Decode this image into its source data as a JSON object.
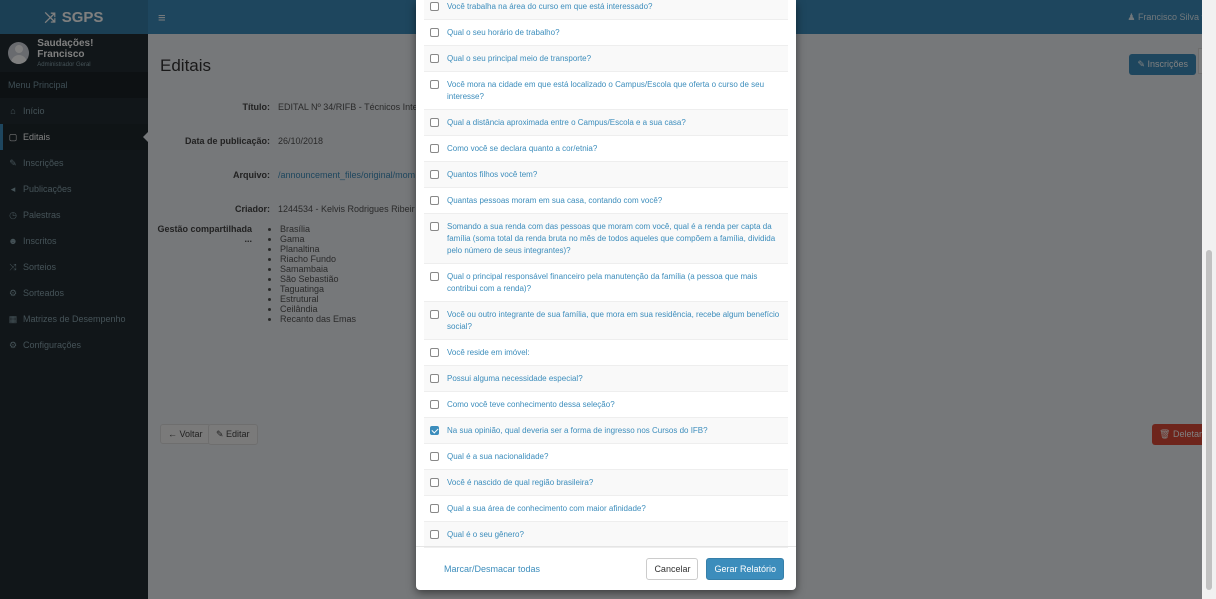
{
  "brand": {
    "name": "SGPS",
    "icon": "shuffle-icon"
  },
  "user": {
    "greeting": "Saudações! Francisco",
    "role": "Administrador Geral"
  },
  "topbar": {
    "menu_icon": "≡",
    "user_name": "Francisco Silva"
  },
  "sidebar": {
    "header": "Menu Principal",
    "items": [
      {
        "label": "Início",
        "icon": "home-icon"
      },
      {
        "label": "Editais",
        "icon": "file-icon"
      },
      {
        "label": "Inscrições",
        "icon": "pencil-icon"
      },
      {
        "label": "Publicações",
        "icon": "bullhorn-icon"
      },
      {
        "label": "Palestras",
        "icon": "clock-icon"
      },
      {
        "label": "Inscritos",
        "icon": "users-icon"
      },
      {
        "label": "Sorteios",
        "icon": "shuffle-icon"
      },
      {
        "label": "Sorteados",
        "icon": "gear-icon"
      },
      {
        "label": "Matrizes de Desempenho",
        "icon": "grid-icon"
      },
      {
        "label": "Configurações",
        "icon": "gears-icon"
      }
    ]
  },
  "page": {
    "title": "Editais",
    "inscricoes_button": "Inscrições",
    "fields": [
      {
        "label": "Título:",
        "value": "EDITAL Nº 34/RIFB - Técnicos Inte"
      },
      {
        "label": "Data de publicação:",
        "value": "26/10/2018"
      },
      {
        "label": "Arquivo:",
        "value": "/announcement_files/original/mom"
      },
      {
        "label": "Criador:",
        "value": "1244534 - Kelvis Rodrigues Ribeir"
      }
    ],
    "shared_label": "Gestão compartilhada ...",
    "shared_list": [
      "Brasília",
      "Gama",
      "Planaltina",
      "Riacho Fundo",
      "Samambaia",
      "São Sebastião",
      "Taguatinga",
      "Estrutural",
      "Ceilândia",
      "Recanto das Emas"
    ],
    "back_button": "Voltar",
    "edit_button": "Editar",
    "delete_button": "Deletar"
  },
  "modal": {
    "questions": [
      {
        "text": "Você trabalha na área do curso em que está interessado?",
        "checked": false
      },
      {
        "text": "Qual o seu horário de trabalho?",
        "checked": false
      },
      {
        "text": "Qual o seu principal meio de transporte?",
        "checked": false
      },
      {
        "text": "Você mora na cidade em que está localizado o Campus/Escola que oferta o curso de seu interesse?",
        "checked": false
      },
      {
        "text": "Qual a distância aproximada entre o Campus/Escola e a sua casa?",
        "checked": false
      },
      {
        "text": "Como você se declara quanto a cor/etnia?",
        "checked": false
      },
      {
        "text": "Quantos filhos você tem?",
        "checked": false
      },
      {
        "text": "Quantas pessoas moram em sua casa, contando com você?",
        "checked": false
      },
      {
        "text": "Somando a sua renda com das pessoas que moram com você, qual é a renda per capta da família (soma total da renda bruta no mês de todos aqueles que compõem a família, dividida pelo número de seus integrantes)?",
        "checked": false
      },
      {
        "text": "Qual o principal responsável financeiro pela manutenção da família (a pessoa que mais contribui com a renda)?",
        "checked": false
      },
      {
        "text": "Você ou outro integrante de sua família, que mora em sua residência, recebe algum benefício social?",
        "checked": false
      },
      {
        "text": "Você reside em imóvel:",
        "checked": false
      },
      {
        "text": "Possui alguma necessidade especial?",
        "checked": false
      },
      {
        "text": "Como você teve conhecimento dessa seleção?",
        "checked": false
      },
      {
        "text": "Na sua opinião, qual deveria ser a forma de ingresso nos Cursos do IFB?",
        "checked": true
      },
      {
        "text": "Qual é a sua nacionalidade?",
        "checked": false
      },
      {
        "text": "Você é nascido de qual região brasileira?",
        "checked": false
      },
      {
        "text": "Qual a sua área de conhecimento com maior afinidade?",
        "checked": false
      },
      {
        "text": "Qual é o seu gênero?",
        "checked": false
      }
    ],
    "toggle_all": "Marcar/Desmacar todas",
    "cancel": "Cancelar",
    "generate": "Gerar Relatório"
  }
}
